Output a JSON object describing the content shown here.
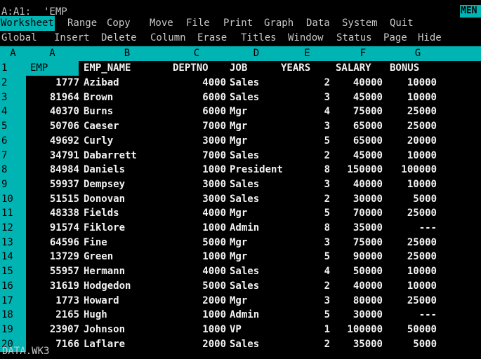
{
  "status": {
    "cell_address": "A:A1:",
    "cell_contents": "'EMP",
    "mode": "MEN"
  },
  "menu": {
    "main": [
      "Worksheet",
      "Range",
      "Copy",
      "Move",
      "File",
      "Print",
      "Graph",
      "Data",
      "System",
      "Quit"
    ],
    "sub": [
      "Global",
      "Insert",
      "Delete",
      "Column",
      "Erase",
      "Titles",
      "Window",
      "Status",
      "Page",
      "Hide"
    ]
  },
  "columns": {
    "sheet": "A",
    "letters": [
      "A",
      "B",
      "C",
      "D",
      "E",
      "F",
      "G"
    ]
  },
  "table": {
    "headers": [
      "EMP",
      "EMP_NAME",
      "DEPTNO",
      "JOB",
      "YEARS",
      "SALARY",
      "BONUS"
    ],
    "rows": [
      {
        "n": "2",
        "emp": "1777",
        "name": "Azibad",
        "dept": "4000",
        "job": "Sales",
        "years": "2",
        "salary": "40000",
        "bonus": "10000"
      },
      {
        "n": "3",
        "emp": "81964",
        "name": "Brown",
        "dept": "6000",
        "job": "Sales",
        "years": "3",
        "salary": "45000",
        "bonus": "10000"
      },
      {
        "n": "4",
        "emp": "40370",
        "name": "Burns",
        "dept": "6000",
        "job": "Mgr",
        "years": "4",
        "salary": "75000",
        "bonus": "25000"
      },
      {
        "n": "5",
        "emp": "50706",
        "name": "Caeser",
        "dept": "7000",
        "job": "Mgr",
        "years": "3",
        "salary": "65000",
        "bonus": "25000"
      },
      {
        "n": "6",
        "emp": "49692",
        "name": "Curly",
        "dept": "3000",
        "job": "Mgr",
        "years": "5",
        "salary": "65000",
        "bonus": "20000"
      },
      {
        "n": "7",
        "emp": "34791",
        "name": "Dabarrett",
        "dept": "7000",
        "job": "Sales",
        "years": "2",
        "salary": "45000",
        "bonus": "10000"
      },
      {
        "n": "8",
        "emp": "84984",
        "name": "Daniels",
        "dept": "1000",
        "job": "President",
        "years": "8",
        "salary": "150000",
        "bonus": "100000"
      },
      {
        "n": "9",
        "emp": "59937",
        "name": "Dempsey",
        "dept": "3000",
        "job": "Sales",
        "years": "3",
        "salary": "40000",
        "bonus": "10000"
      },
      {
        "n": "10",
        "emp": "51515",
        "name": "Donovan",
        "dept": "3000",
        "job": "Sales",
        "years": "2",
        "salary": "30000",
        "bonus": "5000"
      },
      {
        "n": "11",
        "emp": "48338",
        "name": "Fields",
        "dept": "4000",
        "job": "Mgr",
        "years": "5",
        "salary": "70000",
        "bonus": "25000"
      },
      {
        "n": "12",
        "emp": "91574",
        "name": "Fiklore",
        "dept": "1000",
        "job": "Admin",
        "years": "8",
        "salary": "35000",
        "bonus": "---"
      },
      {
        "n": "13",
        "emp": "64596",
        "name": "Fine",
        "dept": "5000",
        "job": "Mgr",
        "years": "3",
        "salary": "75000",
        "bonus": "25000"
      },
      {
        "n": "14",
        "emp": "13729",
        "name": "Green",
        "dept": "1000",
        "job": "Mgr",
        "years": "5",
        "salary": "90000",
        "bonus": "25000"
      },
      {
        "n": "15",
        "emp": "55957",
        "name": "Hermann",
        "dept": "4000",
        "job": "Sales",
        "years": "4",
        "salary": "50000",
        "bonus": "10000"
      },
      {
        "n": "16",
        "emp": "31619",
        "name": "Hodgedon",
        "dept": "5000",
        "job": "Sales",
        "years": "2",
        "salary": "40000",
        "bonus": "10000"
      },
      {
        "n": "17",
        "emp": "1773",
        "name": "Howard",
        "dept": "2000",
        "job": "Mgr",
        "years": "3",
        "salary": "80000",
        "bonus": "25000"
      },
      {
        "n": "18",
        "emp": "2165",
        "name": "Hugh",
        "dept": "1000",
        "job": "Admin",
        "years": "5",
        "salary": "30000",
        "bonus": "---"
      },
      {
        "n": "19",
        "emp": "23907",
        "name": "Johnson",
        "dept": "1000",
        "job": "VP",
        "years": "1",
        "salary": "100000",
        "bonus": "50000"
      },
      {
        "n": "20",
        "emp": "7166",
        "name": "Laflare",
        "dept": "2000",
        "job": "Sales",
        "years": "2",
        "salary": "35000",
        "bonus": "5000"
      }
    ]
  },
  "footer": {
    "filename": "DATA.WK3"
  }
}
